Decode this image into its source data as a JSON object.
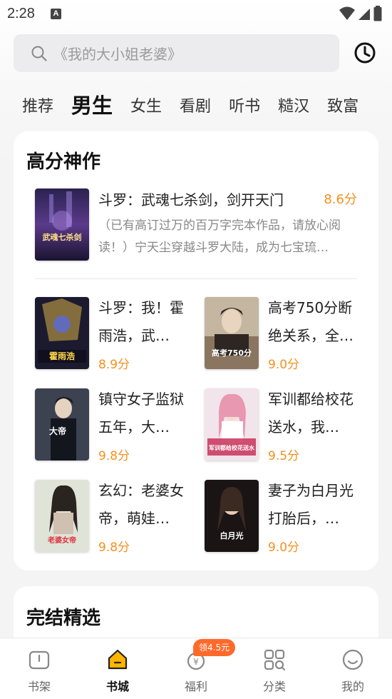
{
  "status_bar": {
    "time": "2:28",
    "notification_icon": "A"
  },
  "search": {
    "placeholder": "《我的大小姐老婆》",
    "icon": "search-icon",
    "history_icon": "clock-icon"
  },
  "tabs": [
    {
      "label": "推荐",
      "active": false
    },
    {
      "label": "男生",
      "active": true
    },
    {
      "label": "女生",
      "active": false
    },
    {
      "label": "看剧",
      "active": false
    },
    {
      "label": "听书",
      "active": false
    },
    {
      "label": "糙汉",
      "active": false
    },
    {
      "label": "致富",
      "active": false
    }
  ],
  "high_score": {
    "title": "高分神作",
    "featured": {
      "title": "斗罗：武魂七杀剑，剑开天门",
      "score": "8.6分",
      "description": "（已有高订过万的百万字完本作品，请放心阅读！）宁天尘穿越斗罗大陆，成为七宝琉…",
      "cover_text": "武魂七杀剑"
    },
    "books": [
      {
        "title": "斗罗：我！霍雨浩，武…",
        "score": "8.9分",
        "cover_text": "霍雨浩"
      },
      {
        "title": "高考750分断绝关系，全…",
        "score": "9.0分",
        "cover_text": "高考750分"
      },
      {
        "title": "镇守女子监狱五年，大…",
        "score": "9.8分",
        "cover_text": "大帝"
      },
      {
        "title": "军训都给校花送水，我…",
        "score": "9.5分",
        "cover_text": "军训都给校花送水"
      },
      {
        "title": "玄幻：老婆女帝，萌娃…",
        "score": "9.8分",
        "cover_text": "老婆女帝"
      },
      {
        "title": "妻子为白月光打胎后，…",
        "score": "9.0分",
        "cover_text": "白月光"
      }
    ]
  },
  "finished_picks": {
    "title": "完结精选"
  },
  "bottom_nav": [
    {
      "label": "书架",
      "icon": "bookshelf-icon",
      "active": false
    },
    {
      "label": "书城",
      "icon": "bookstore-icon",
      "active": true
    },
    {
      "label": "福利",
      "icon": "welfare-icon",
      "active": false,
      "badge": "领4.5元"
    },
    {
      "label": "分类",
      "icon": "category-icon",
      "active": false
    },
    {
      "label": "我的",
      "icon": "profile-icon",
      "active": false
    }
  ],
  "colors": {
    "accent": "#f5901c",
    "badge": "#ff6a2b",
    "background": "#f4f4f4"
  }
}
